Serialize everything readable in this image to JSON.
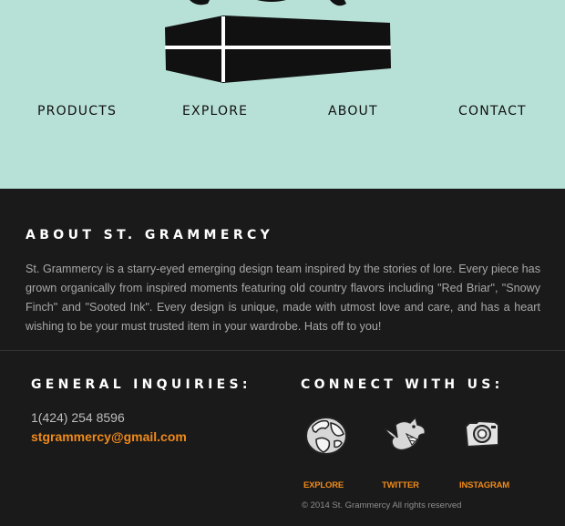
{
  "nav": {
    "products": "PRODUCTS",
    "explore": "EXPLORE",
    "about": "ABOUT",
    "contact": "CONTACT"
  },
  "logo": {
    "icon": "coffin-icon"
  },
  "about": {
    "title": "ABOUT ST. GRAMMERCY",
    "body": "St. Grammercy is a starry-eyed emerging design team inspired by the stories of lore. Every piece has grown organically from inspired moments featuring old country flavors including \"Red Briar\", \"Snowy Finch\" and \"Sooted Ink\". Every design is unique, made with utmost love and care, and has a heart wishing to be your must trusted item in your wardrobe. Hats off to you!"
  },
  "inquiries": {
    "title": "GENERAL INQUIRIES:",
    "phone": "1(424) 254 8596",
    "email": "stgrammercy@gmail.com"
  },
  "connect": {
    "title": "CONNECT WITH US:",
    "links": [
      {
        "label": "EXPLORE",
        "icon": "globe-icon"
      },
      {
        "label": "TWITTER",
        "icon": "bird-icon"
      },
      {
        "label": "INSTAGRAM",
        "icon": "camera-icon"
      }
    ],
    "copyright": "© 2014 St. Grammercy All rights reserved"
  },
  "colors": {
    "header_bg": "#b7e0d6",
    "footer_bg": "#1b1a1a",
    "accent": "#ee8a1a",
    "heading": "#ffffff",
    "body_text": "#a8a8a8"
  }
}
